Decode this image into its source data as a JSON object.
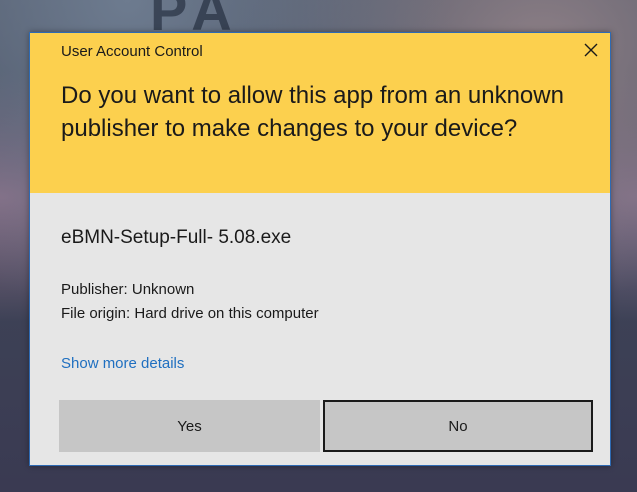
{
  "dialog": {
    "app_title": "User Account Control",
    "question": "Do you want to allow this app from an unknown publisher to make changes to your device?",
    "app_name": "eBMN-Setup-Full- 5.08.exe",
    "publisher": "Publisher: Unknown",
    "file_origin": "File origin: Hard drive on this computer",
    "more_details": "Show more details",
    "yes_label": "Yes",
    "no_label": "No"
  },
  "colors": {
    "header": "#fcd04e",
    "body": "#e6e6e6",
    "link": "#1f6fc0",
    "button": "#c6c6c6"
  },
  "icons": {
    "close": "close-icon"
  }
}
